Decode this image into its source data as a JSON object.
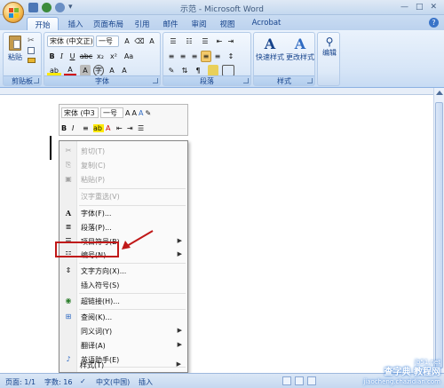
{
  "window": {
    "title": "示范 - Microsoft Word",
    "controls": [
      "—",
      "□",
      "✕"
    ]
  },
  "tabs": [
    "开始",
    "插入",
    "页面布局",
    "引用",
    "邮件",
    "审阅",
    "视图",
    "Acrobat"
  ],
  "ribbon": {
    "clipboard": {
      "paste": "粘贴",
      "label": "剪贴板"
    },
    "font": {
      "name": "宋体 (中文正)",
      "size": "一号",
      "label": "字体"
    },
    "paragraph": {
      "label": "段落"
    },
    "styles": {
      "quick": "快速样式",
      "change": "更改样式",
      "label": "样式"
    },
    "editing": {
      "label": "编辑"
    }
  },
  "mini_toolbar": {
    "font": "宋体 (中3",
    "size": "一号"
  },
  "context_menu": [
    {
      "label": "剪切(T)",
      "enabled": false,
      "icon": "scissors-icon"
    },
    {
      "label": "复制(C)",
      "enabled": false,
      "icon": "copy-icon"
    },
    {
      "label": "粘贴(P)",
      "enabled": false,
      "icon": "paste-icon"
    },
    {
      "label": "汉字重选(V)",
      "enabled": false
    },
    {
      "label": "字体(F)...",
      "enabled": true,
      "icon": "font-icon"
    },
    {
      "label": "段落(P)...",
      "enabled": true,
      "icon": "paragraph-icon"
    },
    {
      "label": "项目符号(B)",
      "enabled": true,
      "icon": "bullets-icon",
      "submenu": true
    },
    {
      "label": "编号(N)",
      "enabled": true,
      "icon": "numbering-icon",
      "submenu": true
    },
    {
      "label": "文字方向(X)...",
      "enabled": true,
      "icon": "text-direction-icon"
    },
    {
      "label": "插入符号(S)",
      "enabled": true
    },
    {
      "label": "超链接(H)...",
      "enabled": true,
      "icon": "hyperlink-icon"
    },
    {
      "label": "查阅(K)...",
      "enabled": true,
      "icon": "research-icon"
    },
    {
      "label": "同义词(Y)",
      "enabled": true,
      "submenu": true
    },
    {
      "label": "翻译(A)",
      "enabled": true,
      "submenu": true
    },
    {
      "label": "英语助手(E)",
      "enabled": true,
      "icon": "english-assistant-icon"
    },
    {
      "label": "样式(T)",
      "enabled": true,
      "submenu": true
    }
  ],
  "status": {
    "page": "页面: 1/1",
    "words": "字数: 16",
    "language": "中文(中国)",
    "mode": "插入"
  },
  "watermark": {
    "line1": "查字典 教程网",
    "line2": "jiaocheng.chazidian.com",
    "corner": "jb51.net"
  }
}
